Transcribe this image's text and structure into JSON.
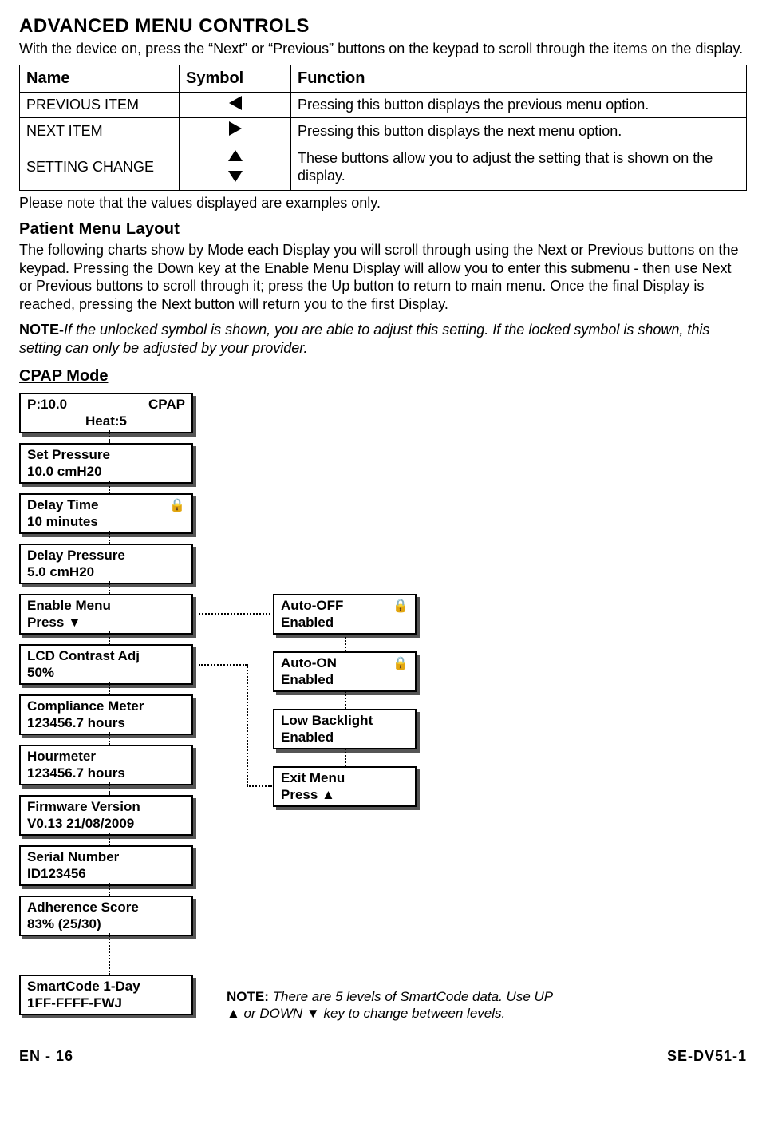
{
  "title": "ADVANCED MENU CONTROLS",
  "intro": "With the device on, press the “Next” or “Previous” buttons on the keypad to scroll through the items on the display.",
  "table": {
    "headers": {
      "name": "Name",
      "symbol": "Symbol",
      "function": "Function"
    },
    "rows": [
      {
        "name": "PREVIOUS ITEM",
        "symbol": "left",
        "function": "Pressing this button displays the previous menu option."
      },
      {
        "name": "NEXT ITEM",
        "symbol": "right",
        "function": "Pressing this button displays the next menu option."
      },
      {
        "name": "SETTING CHANGE",
        "symbol": "up-down",
        "function": "These buttons allow you to adjust the setting that is shown on the display."
      }
    ]
  },
  "note_values": "Please note that the values displayed are examples only.",
  "section_title": "Patient Menu Layout",
  "para1": "The following charts show by Mode each Display you will scroll through using the Next or Previous buttons on the keypad. Pressing the Down key at the Enable Menu Display will allow you to enter this submenu - then use Next or Previous buttons to scroll through it; press the Up button to return to main menu. Once the final Display is reached, pressing the Next button will return you to the first Display.",
  "note_lock_prefix": "NOTE-",
  "note_lock": "If the unlocked symbol is shown, you are able to adjust this setting. If the locked symbol is shown, this setting can only be adjusted by your provider.",
  "mode_title": "CPAP Mode",
  "main_menu": [
    {
      "line1": "P:10.0",
      "right": "CPAP",
      "line2": "Heat:5"
    },
    {
      "line1": "Set Pressure",
      "line2": "10.0 cmH20"
    },
    {
      "line1": "Delay Time",
      "line2": "10 minutes",
      "lock": true
    },
    {
      "line1": "Delay Pressure",
      "line2": "5.0 cmH20"
    },
    {
      "line1": "Enable Menu",
      "line2": "Press ▼"
    },
    {
      "line1": "LCD Contrast Adj",
      "line2": "50%"
    },
    {
      "line1": "Compliance Meter",
      "line2": "123456.7 hours"
    },
    {
      "line1": "Hourmeter",
      "line2": "123456.7 hours"
    },
    {
      "line1": "Firmware Version",
      "line2": "V0.13 21/08/2009"
    },
    {
      "line1": "Serial Number",
      "line2": "ID123456"
    },
    {
      "line1": "Adherence  Score",
      "line2": " 83% (25/30)"
    },
    {
      "line1": "SmartCode 1-Day",
      "line2": "1FF-FFFF-FWJ"
    }
  ],
  "sub_menu": [
    {
      "line1": "Auto-OFF",
      "line2": "Enabled",
      "lock": true
    },
    {
      "line1": "Auto-ON",
      "line2": "Enabled",
      "lock": true
    },
    {
      "line1": "Low Backlight",
      "line2": "Enabled"
    },
    {
      "line1": "Exit Menu",
      "line2": "Press ▲"
    }
  ],
  "smartcode_note_prefix": "NOTE:",
  "smartcode_note": " There are 5 levels of SmartCode data. Use UP ▲ or DOWN ▼ key to change between levels.",
  "footer_left": "EN - 16",
  "footer_right": "SE-DV51-1"
}
